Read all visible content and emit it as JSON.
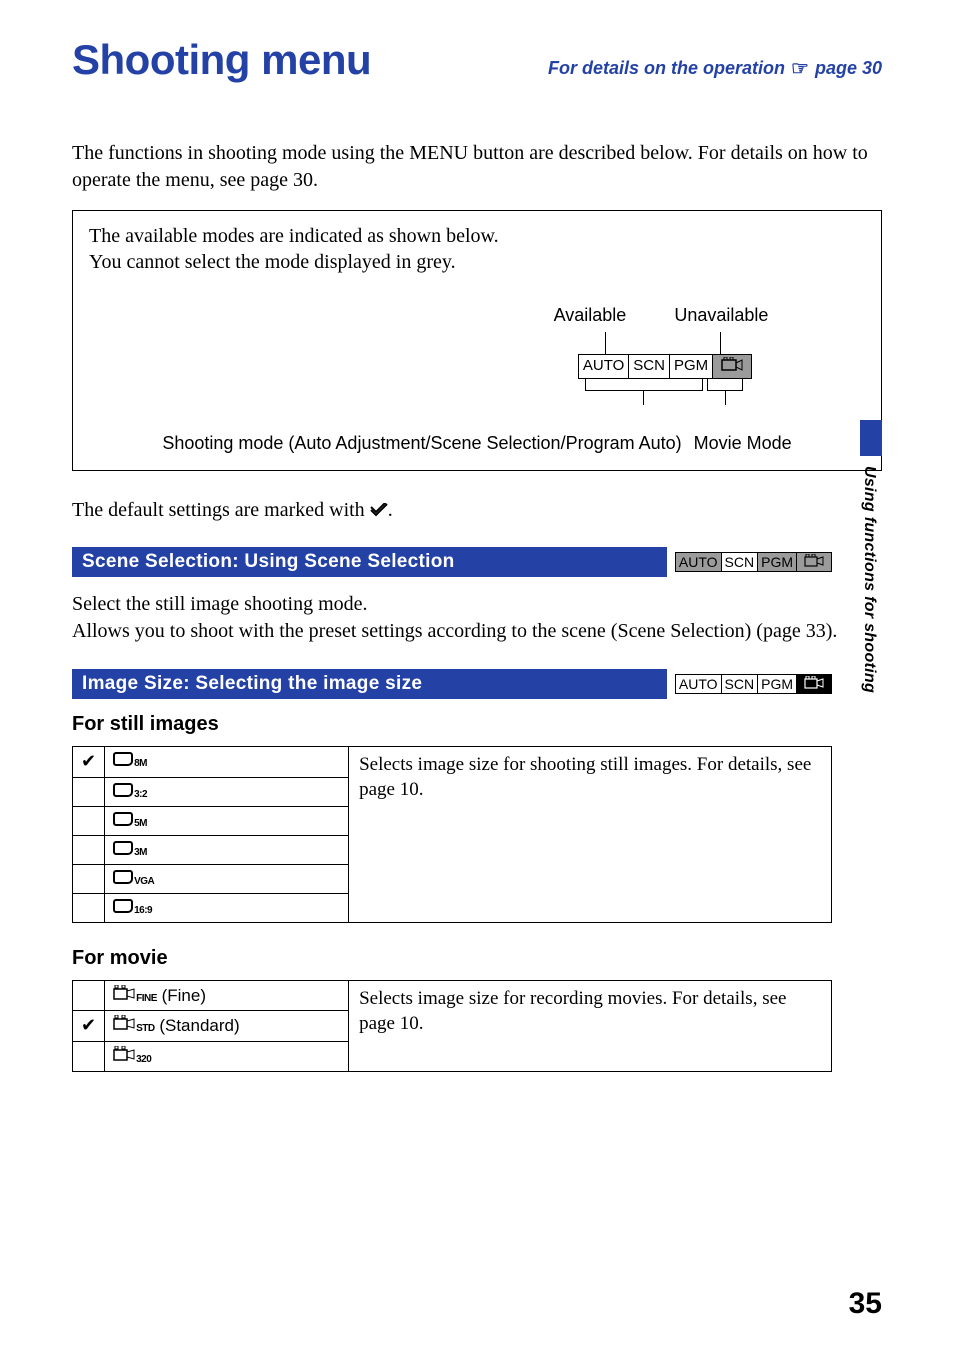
{
  "header": {
    "title": "Shooting menu",
    "detail_text": "For details on the operation",
    "page_ref": "page 30"
  },
  "intro": "The functions in shooting mode using the MENU button are described below. For details on how to operate the menu, see page 30.",
  "mode_box": {
    "line1": "The available modes are indicated as shown below.",
    "line2": "You cannot select the mode displayed in grey.",
    "label_available": "Available",
    "label_unavailable": "Unavailable",
    "modes": [
      "AUTO",
      "SCN",
      "PGM"
    ],
    "caption_left": "Shooting mode (Auto Adjustment/Scene Selection/Program Auto)",
    "caption_right": "Movie Mode"
  },
  "default_note_prefix": "The default settings are marked with ",
  "default_note_suffix": ".",
  "section_scene": {
    "title": "Scene Selection: Using Scene Selection",
    "badges": {
      "auto": "AUTO",
      "scn": "SCN",
      "pgm": "PGM"
    },
    "text": "Select the still image shooting mode.\nAllows you to shoot with the preset settings according to the scene (Scene Selection) (page 33)."
  },
  "section_image": {
    "title": "Image Size: Selecting the image size",
    "badges": {
      "auto": "AUTO",
      "scn": "SCN",
      "pgm": "PGM"
    },
    "still_heading": "For still images",
    "still_desc": "Selects image size for shooting still images. For details, see page 10.",
    "still_options": [
      {
        "checked": true,
        "label_sub": "8M"
      },
      {
        "checked": false,
        "label_sub": "3:2"
      },
      {
        "checked": false,
        "label_sub": "5M"
      },
      {
        "checked": false,
        "label_sub": "3M"
      },
      {
        "checked": false,
        "label_sub": "VGA"
      },
      {
        "checked": false,
        "label_sub": "16:9"
      }
    ],
    "movie_heading": "For movie",
    "movie_desc": "Selects image size for recording movies. For details, see page 10.",
    "movie_options": [
      {
        "checked": false,
        "label_sub": "FINE",
        "suffix": " (Fine)"
      },
      {
        "checked": true,
        "label_sub": "STD",
        "suffix": " (Standard)"
      },
      {
        "checked": false,
        "label_sub": "320",
        "suffix": ""
      }
    ]
  },
  "side_tab": "Using functions for shooting",
  "page_number": "35"
}
